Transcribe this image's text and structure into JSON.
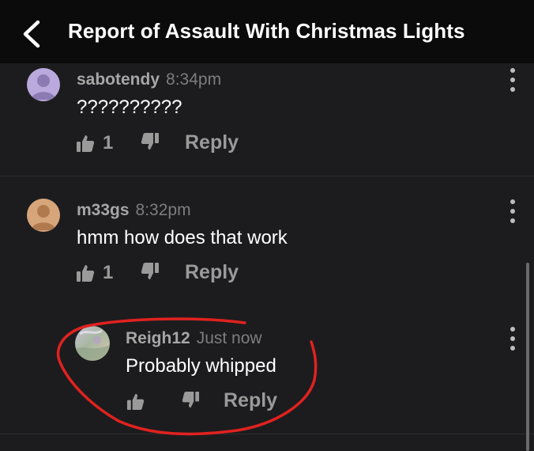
{
  "header": {
    "back_icon": "chevron-left-icon",
    "title": "Report of Assault With Christmas Lights"
  },
  "comments": [
    {
      "author": "sabotendy",
      "time": "8:34pm",
      "text": "??????????",
      "likes": "1",
      "reply_label": "Reply",
      "avatar_color": "#b9a9dc"
    },
    {
      "author": "m33gs",
      "time": "8:32pm",
      "text": "hmm how does that work",
      "likes": "1",
      "reply_label": "Reply",
      "avatar_color": "#d7a57a"
    },
    {
      "author": "Reigh12",
      "time": "Just now",
      "text": "Probably whipped",
      "likes": "",
      "reply_label": "Reply"
    }
  ],
  "colors": {
    "background": "#1c1c1e",
    "header_bg": "#0b0b0b",
    "annotation_stroke": "#e0221f"
  }
}
